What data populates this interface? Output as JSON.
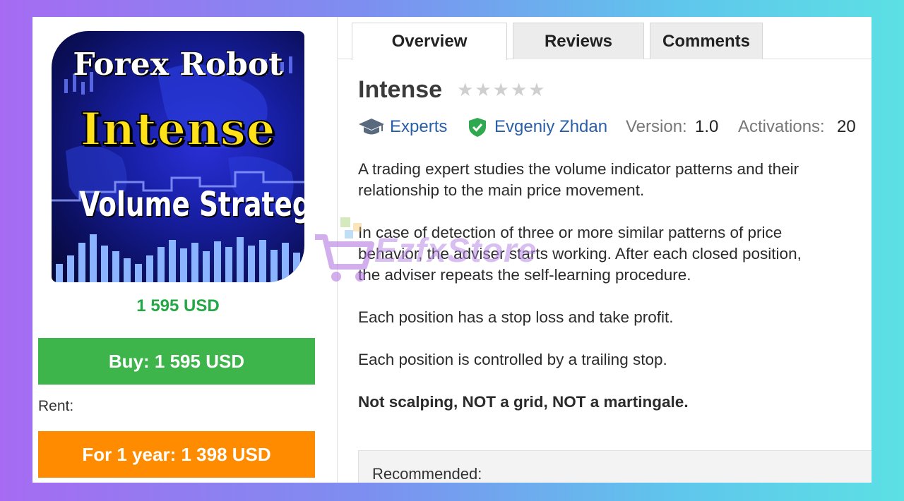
{
  "product": {
    "image": {
      "line1": "Forex Robot",
      "line2": "Intense",
      "line3": "Volume Strategy"
    },
    "price": "1 595 USD",
    "buy_label": "Buy: 1 595 USD",
    "rent_label": "Rent:",
    "rent_button_label": "For 1 year: 1 398 USD"
  },
  "tabs": [
    {
      "label": "Overview",
      "active": true
    },
    {
      "label": "Reviews",
      "active": false
    },
    {
      "label": "Comments",
      "active": false
    }
  ],
  "title": "Intense",
  "rating": {
    "stars_filled": 0,
    "stars_total": 5
  },
  "meta": {
    "category": "Experts",
    "author": "Evgeniy Zhdan",
    "version_label": "Version:",
    "version_value": "1.0",
    "activations_label": "Activations:",
    "activations_value": "20"
  },
  "description": {
    "p1_line1": "A trading expert studies the volume indicator patterns and their",
    "p1_line2": "relationship to the main price movement.",
    "p2_line1": "In case of detection of three or more similar patterns of price",
    "p2_line2": "behavior, the adviser starts working. After each closed position,",
    "p2_line3": "the adviser repeats the self-learning procedure.",
    "p3": "Each position has a stop loss and take profit.",
    "p4": "Each position is controlled by a trailing stop.",
    "p5": "Not scalping, NOT a grid, NOT a martingale."
  },
  "recommended_label": "Recommended:",
  "watermark": "EzfxStore",
  "colors": {
    "buy": "#3db54a",
    "rent": "#ff8c00",
    "price": "#23a845",
    "link": "#2a5fa8"
  }
}
